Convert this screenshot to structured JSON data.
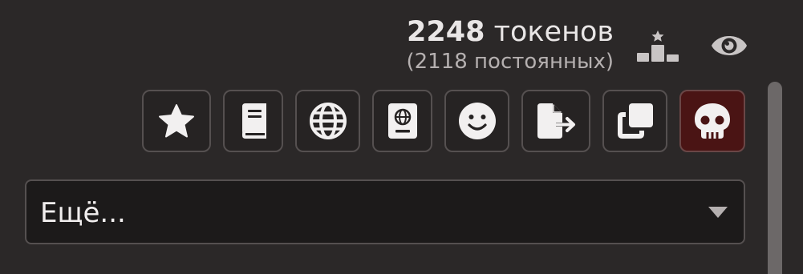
{
  "tokens": {
    "count": "2248",
    "label": " токенов",
    "permanent": "(2118 постоянных)"
  },
  "top_icons": {
    "stats": "podium-stats-icon",
    "eye": "eye-icon"
  },
  "buttons": [
    {
      "icon": "star-icon"
    },
    {
      "icon": "book-icon"
    },
    {
      "icon": "globe-icon"
    },
    {
      "icon": "passport-icon"
    },
    {
      "icon": "smiley-icon"
    },
    {
      "icon": "file-export-icon"
    },
    {
      "icon": "clone-icon"
    },
    {
      "icon": "skull-icon"
    }
  ],
  "more_select": {
    "label": "Ещё..."
  },
  "colors": {
    "background": "#2b2828",
    "danger": "#4a1414",
    "icon": "#f2f0f0",
    "secondary_icon": "#c9c5c5"
  }
}
